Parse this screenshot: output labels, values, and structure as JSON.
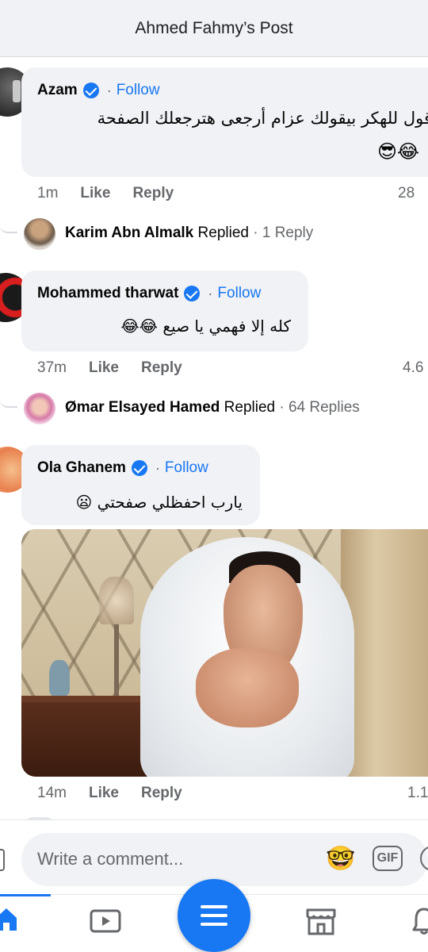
{
  "header": {
    "title": "Ahmed Fahmy’s Post"
  },
  "comments": [
    {
      "author": "Azam",
      "verified": true,
      "follow_label": "Follow",
      "text": "قول للهكر بيقولك عزام أرجعى هترجعلك الصفحة",
      "text_line2": "😂😎",
      "time": "1m",
      "like": "Like",
      "reply": "Reply",
      "reactions": "28"
    },
    {
      "author": "Mohammed tharwat",
      "verified": true,
      "follow_label": "Follow",
      "text": "كله إلا فهمي يا صيع 😂😂",
      "time": "37m",
      "like": "Like",
      "reply": "Reply",
      "reactions": "4.6"
    },
    {
      "author": "Ola Ghanem",
      "verified": true,
      "follow_label": "Follow",
      "text": "يارب احفظلي صفحتي 😦",
      "time": "14m",
      "like": "Like",
      "reply": "Reply",
      "reactions": "1.1"
    }
  ],
  "replies": [
    {
      "name": "Karim Abn Almalk",
      "replied": "Replied",
      "count": "· 1 Reply"
    },
    {
      "name": "Ømar Elsayed Hamed",
      "replied": "Replied",
      "count": "· 64 Replies"
    }
  ],
  "composer": {
    "placeholder": "Write a comment...",
    "avatar_icon": "🤓",
    "gif_label": "GIF"
  },
  "tabbar": {
    "items": [
      "home-icon",
      "watch-icon",
      "menu-icon",
      "marketplace-icon",
      "notifications-icon"
    ],
    "accent": "#1877f2"
  },
  "colors": {
    "accent": "#1877f2",
    "bubble": "#f0f2f5",
    "secondary_text": "#65676b"
  }
}
